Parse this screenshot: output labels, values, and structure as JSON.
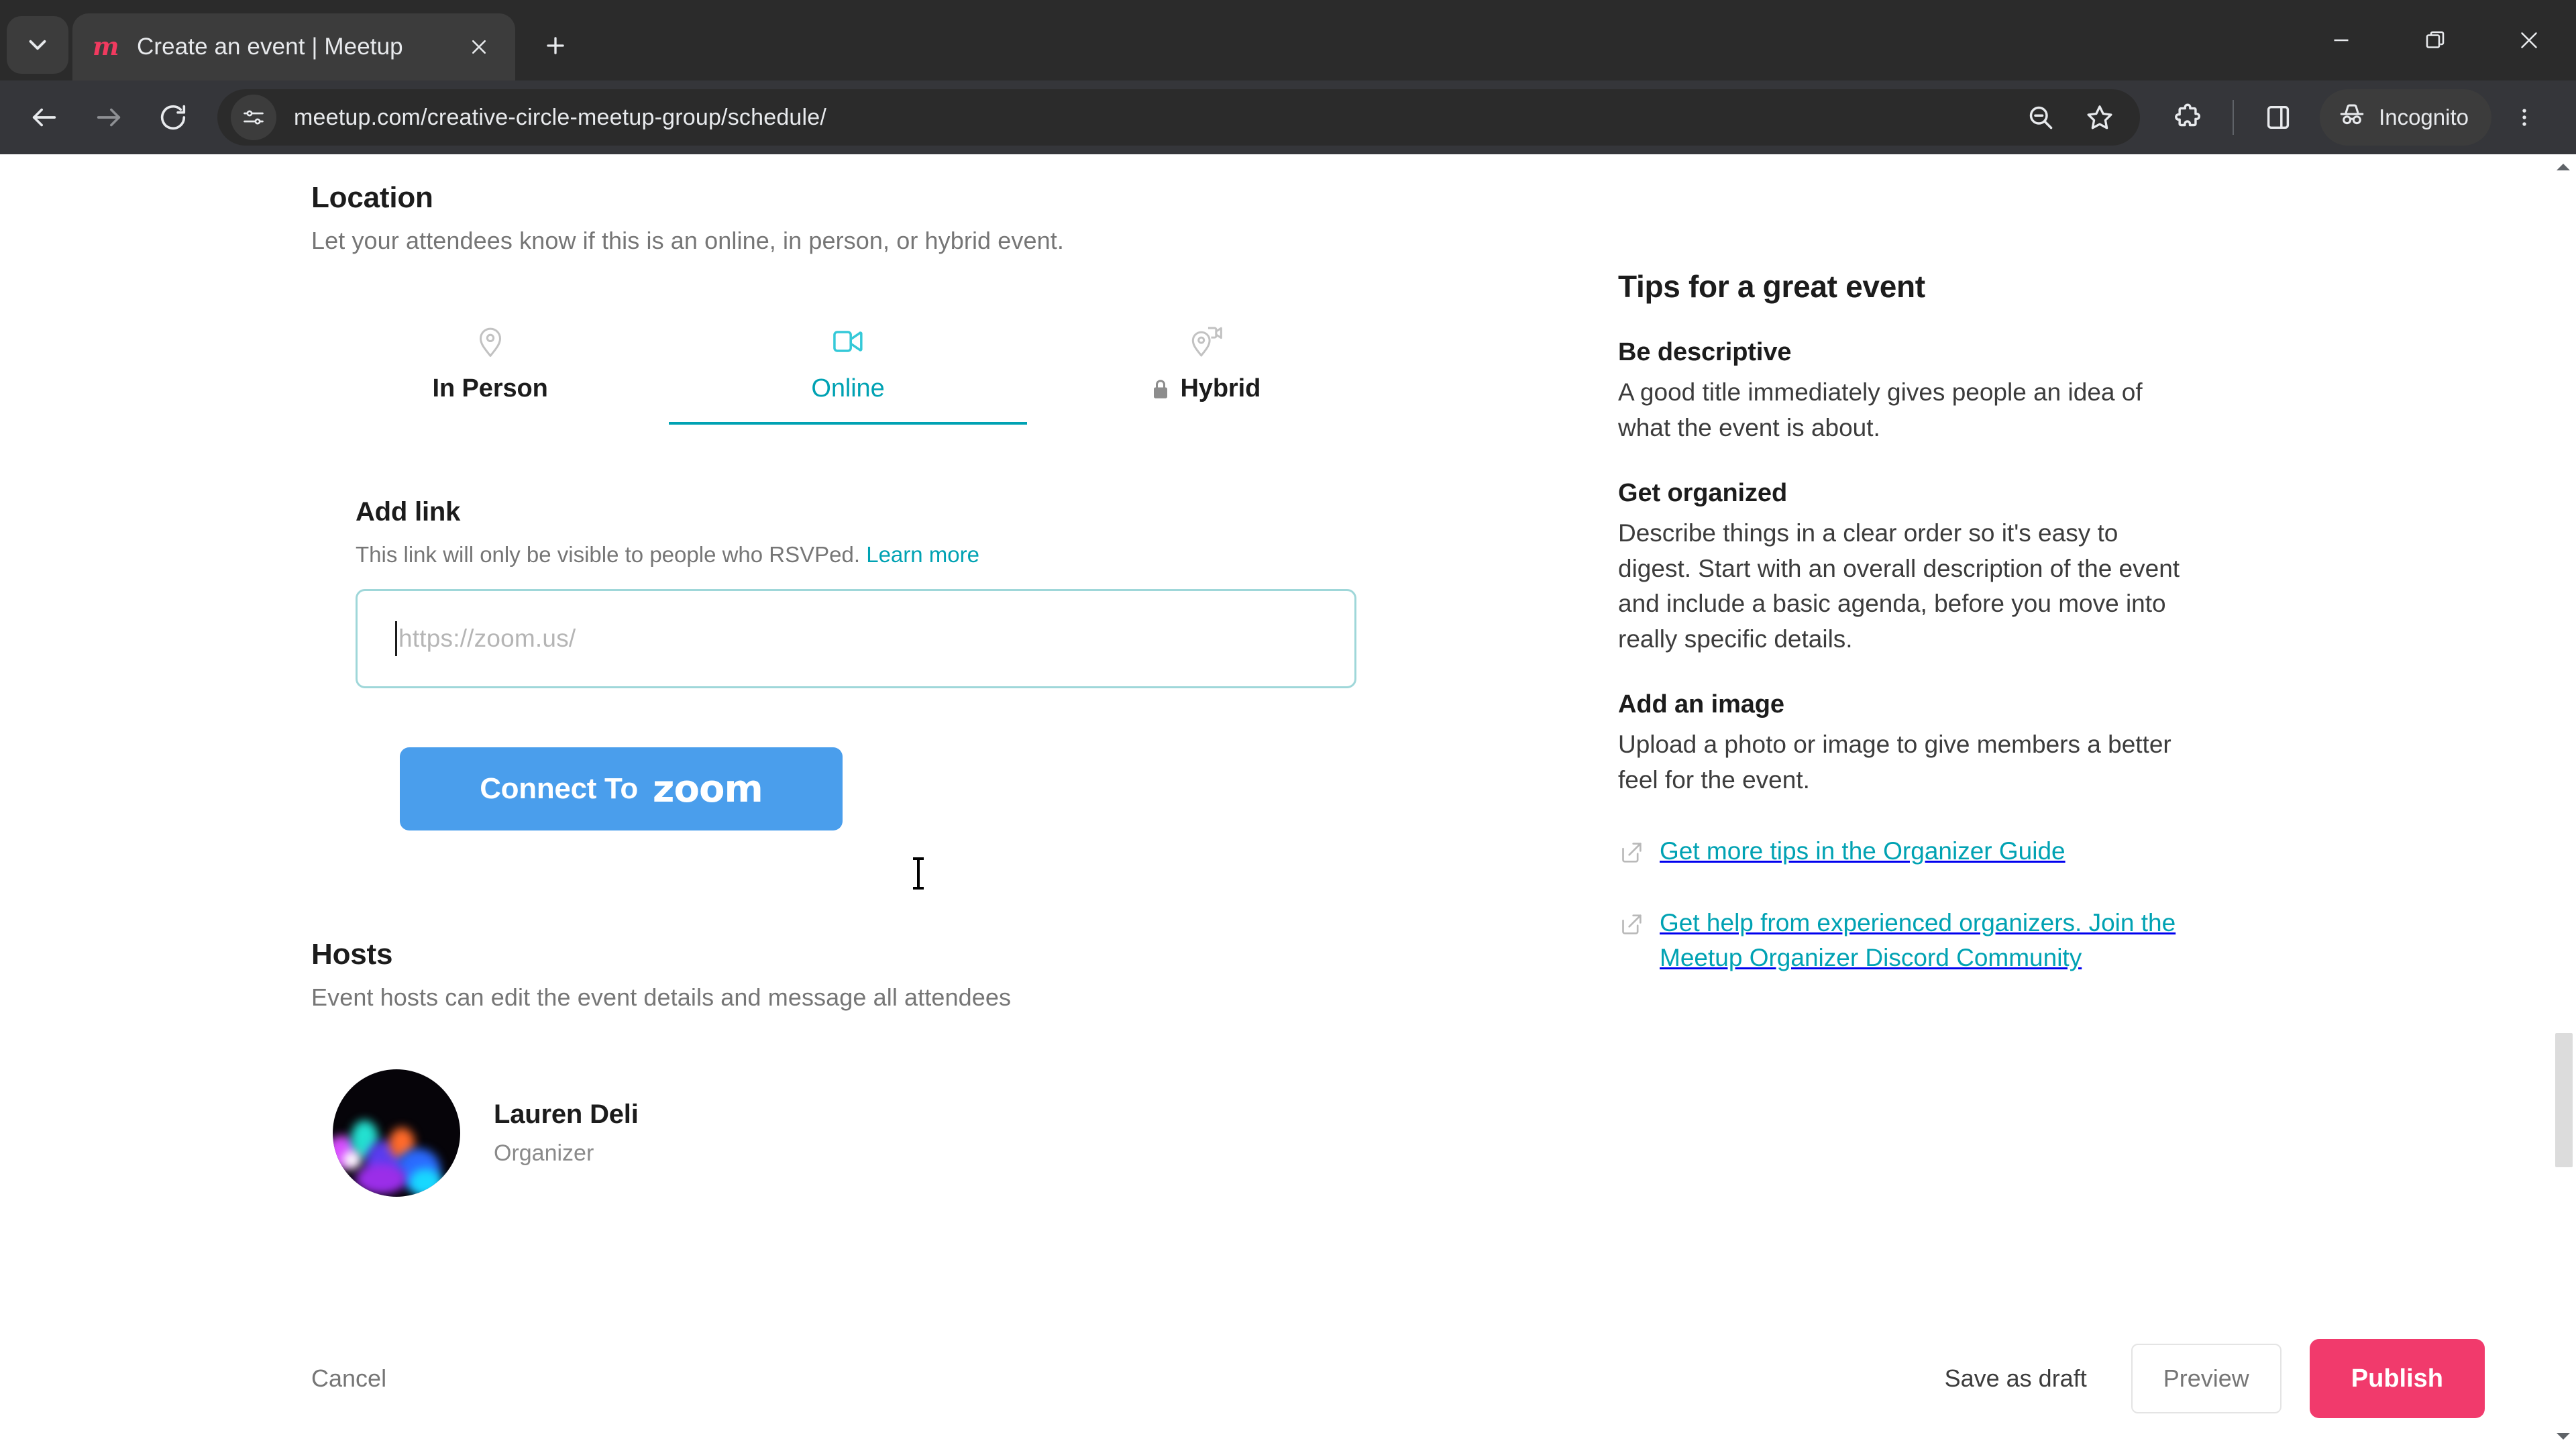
{
  "browser": {
    "tab": {
      "title": "Create an event | Meetup",
      "favicon": "meetup-logo-icon",
      "close_icon": "close-icon"
    },
    "tab_search_icon": "tab-search-chevron-icon",
    "new_tab_icon": "plus-icon",
    "window_controls": {
      "minimize": "minimize-icon",
      "maximize": "maximize-icon",
      "close": "close-icon"
    },
    "nav": {
      "back": "back-arrow-icon",
      "forward": "forward-arrow-icon",
      "reload": "reload-icon"
    },
    "omnibox": {
      "site_settings_icon": "tune-settings-icon",
      "url": "meetup.com/creative-circle-meetup-group/schedule/",
      "zoom_out_icon": "zoom-out-magnifier-icon",
      "bookmark_icon": "star-icon"
    },
    "extensions_icon": "extensions-puzzle-icon",
    "side_panel_icon": "side-panel-icon",
    "profile_chip": {
      "label": "Incognito",
      "icon": "incognito-hat-glasses-icon"
    },
    "menu_icon": "three-dot-menu-icon"
  },
  "page": {
    "location": {
      "title": "Location",
      "subtitle": "Let your attendees know if this is an online, in person, or hybrid event.",
      "tabs": [
        {
          "label": "In Person",
          "icon": "map-pin-icon",
          "active": false,
          "locked": false
        },
        {
          "label": "Online",
          "icon": "video-camera-icon",
          "active": true,
          "locked": false
        },
        {
          "label": "Hybrid",
          "icon": "map-pin-video-icon",
          "active": false,
          "locked": true
        }
      ]
    },
    "add_link": {
      "title": "Add link",
      "helper_text": "This link will only be visible to people who RSVPed.",
      "learn_more": "Learn more",
      "input_placeholder": "https://zoom.us/",
      "input_value": "",
      "zoom_button": {
        "prefix": "Connect To",
        "logo": "zoom",
        "color": "#4a9eec"
      }
    },
    "hosts": {
      "title": "Hosts",
      "subtitle": "Event hosts can edit the event details and message all attendees",
      "people": [
        {
          "name": "Lauren Deli",
          "role": "Organizer",
          "avatar": "night-city-neon-photo"
        }
      ]
    },
    "tips": {
      "title": "Tips for a great event",
      "items": [
        {
          "heading": "Be descriptive",
          "body": "A good title immediately gives people an idea of what the event is about."
        },
        {
          "heading": "Get organized",
          "body": "Describe things in a clear order so it's easy to digest. Start with an overall description of the event and include a basic agenda, before you move into really specific details."
        },
        {
          "heading": "Add an image",
          "body": "Upload a photo or image to give members a better feel for the event."
        }
      ],
      "links": [
        {
          "text": "Get more tips in the Organizer Guide",
          "icon": "external-link-icon"
        },
        {
          "text": "Get help from experienced organizers. Join the Meetup Organizer Discord Community",
          "icon": "external-link-icon"
        }
      ]
    },
    "footer": {
      "cancel": "Cancel",
      "save_draft": "Save as draft",
      "preview": "Preview",
      "publish": "Publish"
    },
    "colors": {
      "accent_teal": "#00a2b3",
      "publish_pink": "#f13a6c",
      "zoom_blue": "#4a9eec"
    }
  }
}
